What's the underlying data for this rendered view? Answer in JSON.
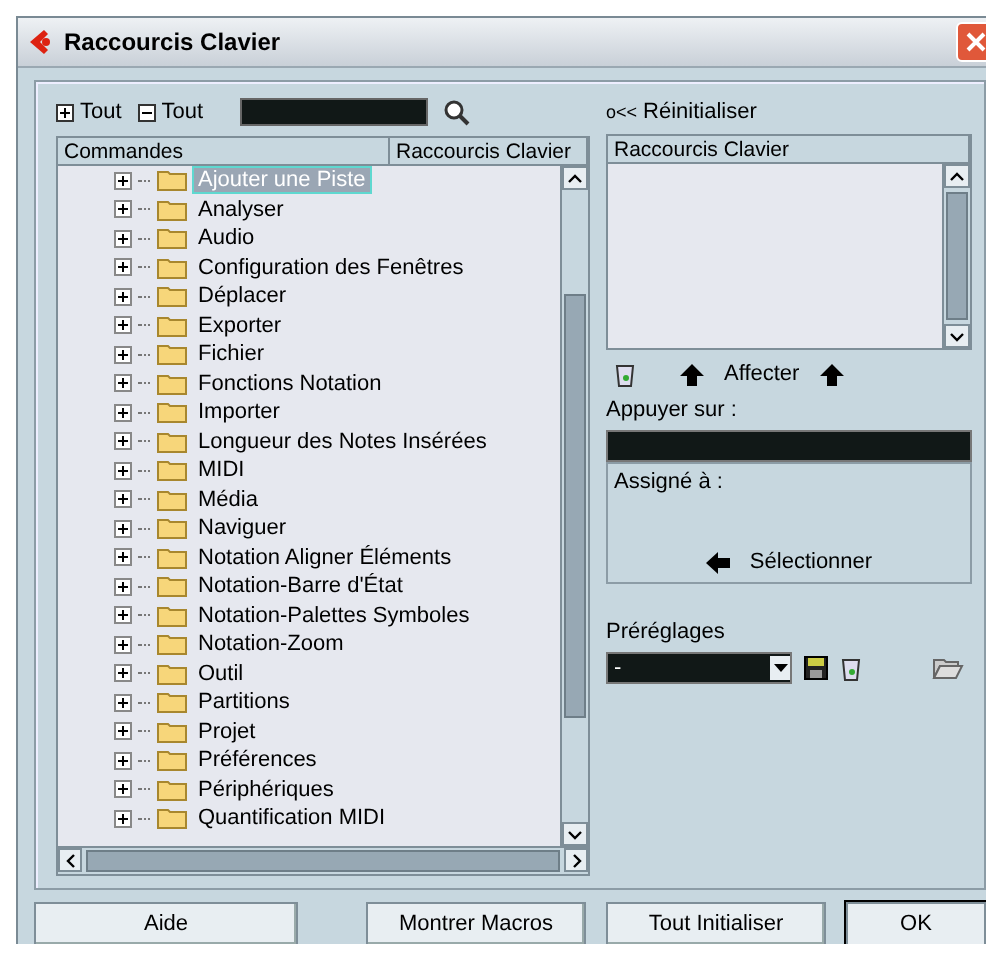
{
  "window": {
    "title": "Raccourcis Clavier"
  },
  "toolbar": {
    "expand_all": "Tout",
    "collapse_all": "Tout",
    "search": {
      "kind": "dark"
    }
  },
  "reset": {
    "symbol": "o<<",
    "label": "Réinitialiser"
  },
  "commands": {
    "columns": [
      "Commandes",
      "Raccourcis Clavier"
    ],
    "items": [
      {
        "label": "Ajouter une Piste",
        "selected": true
      },
      {
        "label": "Analyser",
        "selected": false
      },
      {
        "label": "Audio",
        "selected": false
      },
      {
        "label": "Configuration des Fenêtres",
        "selected": false
      },
      {
        "label": "Déplacer",
        "selected": false
      },
      {
        "label": "Exporter",
        "selected": false
      },
      {
        "label": "Fichier",
        "selected": false
      },
      {
        "label": "Fonctions Notation",
        "selected": false
      },
      {
        "label": "Importer",
        "selected": false
      },
      {
        "label": "Longueur des Notes Insérées",
        "selected": false
      },
      {
        "label": "MIDI",
        "selected": false
      },
      {
        "label": "Média",
        "selected": false
      },
      {
        "label": "Naviguer",
        "selected": false
      },
      {
        "label": "Notation Aligner Éléments",
        "selected": false
      },
      {
        "label": "Notation-Barre d'État",
        "selected": false
      },
      {
        "label": "Notation-Palettes Symboles",
        "selected": false
      },
      {
        "label": "Notation-Zoom",
        "selected": false
      },
      {
        "label": "Outil",
        "selected": false
      },
      {
        "label": "Partitions",
        "selected": false
      },
      {
        "label": "Projet",
        "selected": false
      },
      {
        "label": "Préférences",
        "selected": false
      },
      {
        "label": "Périphériques",
        "selected": false
      },
      {
        "label": "Quantification MIDI",
        "selected": false
      }
    ]
  },
  "shortcuts": {
    "column": "Raccourcis Clavier"
  },
  "assign": {
    "label": "Affecter"
  },
  "press_on": {
    "label": "Appuyer sur :"
  },
  "assigned_to": {
    "label": "Assigné à :",
    "select": "Sélectionner"
  },
  "presets": {
    "label": "Préréglages",
    "value": "-"
  },
  "buttons": [
    {
      "label": "Aide",
      "default": false
    },
    {
      "label": "Montrer Macros",
      "default": false
    },
    {
      "label": "Tout Initialiser",
      "default": false
    },
    {
      "label": "OK",
      "default": true
    }
  ]
}
